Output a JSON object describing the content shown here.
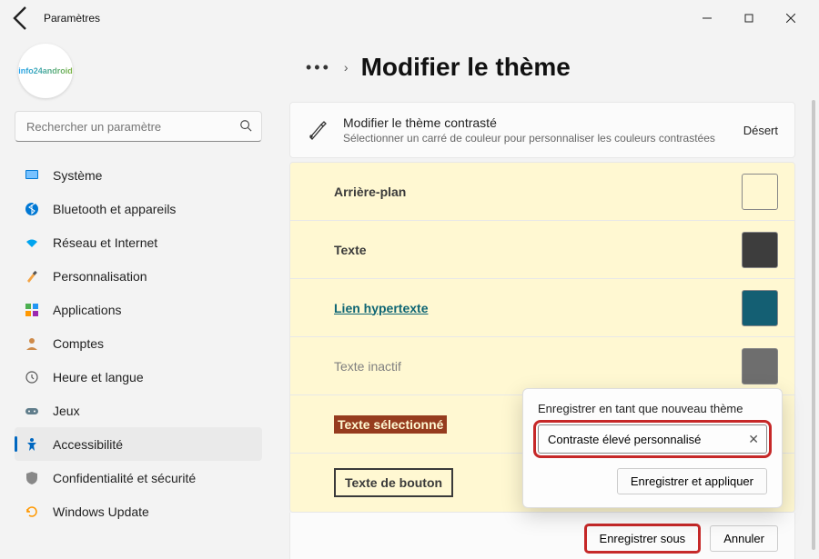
{
  "window": {
    "app_title": "Paramètres"
  },
  "sidebar": {
    "avatar_text": "info24android",
    "search_placeholder": "Rechercher un paramètre",
    "items": [
      {
        "label": "Système"
      },
      {
        "label": "Bluetooth et appareils"
      },
      {
        "label": "Réseau et Internet"
      },
      {
        "label": "Personnalisation"
      },
      {
        "label": "Applications"
      },
      {
        "label": "Comptes"
      },
      {
        "label": "Heure et langue"
      },
      {
        "label": "Jeux"
      },
      {
        "label": "Accessibilité"
      },
      {
        "label": "Confidentialité et sécurité"
      },
      {
        "label": "Windows Update"
      }
    ]
  },
  "breadcrumb": {
    "page_title": "Modifier le thème"
  },
  "header_card": {
    "title": "Modifier le thème contrasté",
    "description": "Sélectionner un carré de couleur pour personnaliser les couleurs contrastées",
    "preset": "Désert"
  },
  "theme_rows": {
    "background": {
      "label": "Arrière-plan",
      "color": "#fff8d2"
    },
    "text": {
      "label": "Texte",
      "color": "#3d3d3d"
    },
    "hyperlink": {
      "label": "Lien hypertexte",
      "color": "#145f73"
    },
    "inactive": {
      "label": "Texte inactif",
      "color": "#6e6e6e"
    },
    "selected": {
      "label": "Texte sélectionné",
      "color": "#963c1e"
    },
    "button": {
      "label": "Texte de bouton",
      "color": "#fff8d2"
    }
  },
  "actions": {
    "save_as": "Enregistrer sous",
    "cancel": "Annuler"
  },
  "popup": {
    "title": "Enregistrer en tant que nouveau thème",
    "field_value": "Contraste élevé personnalisé",
    "save_apply": "Enregistrer et appliquer"
  }
}
